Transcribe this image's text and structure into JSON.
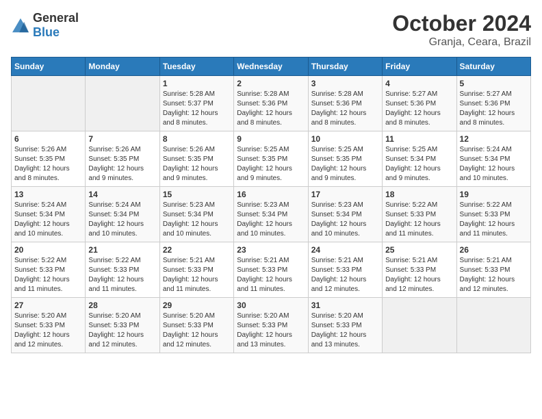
{
  "logo": {
    "general": "General",
    "blue": "Blue"
  },
  "title": {
    "month": "October 2024",
    "location": "Granja, Ceara, Brazil"
  },
  "weekdays": [
    "Sunday",
    "Monday",
    "Tuesday",
    "Wednesday",
    "Thursday",
    "Friday",
    "Saturday"
  ],
  "weeks": [
    [
      {
        "day": "",
        "info": ""
      },
      {
        "day": "",
        "info": ""
      },
      {
        "day": "1",
        "info": "Sunrise: 5:28 AM\nSunset: 5:37 PM\nDaylight: 12 hours and 8 minutes."
      },
      {
        "day": "2",
        "info": "Sunrise: 5:28 AM\nSunset: 5:36 PM\nDaylight: 12 hours and 8 minutes."
      },
      {
        "day": "3",
        "info": "Sunrise: 5:28 AM\nSunset: 5:36 PM\nDaylight: 12 hours and 8 minutes."
      },
      {
        "day": "4",
        "info": "Sunrise: 5:27 AM\nSunset: 5:36 PM\nDaylight: 12 hours and 8 minutes."
      },
      {
        "day": "5",
        "info": "Sunrise: 5:27 AM\nSunset: 5:36 PM\nDaylight: 12 hours and 8 minutes."
      }
    ],
    [
      {
        "day": "6",
        "info": "Sunrise: 5:26 AM\nSunset: 5:35 PM\nDaylight: 12 hours and 8 minutes."
      },
      {
        "day": "7",
        "info": "Sunrise: 5:26 AM\nSunset: 5:35 PM\nDaylight: 12 hours and 9 minutes."
      },
      {
        "day": "8",
        "info": "Sunrise: 5:26 AM\nSunset: 5:35 PM\nDaylight: 12 hours and 9 minutes."
      },
      {
        "day": "9",
        "info": "Sunrise: 5:25 AM\nSunset: 5:35 PM\nDaylight: 12 hours and 9 minutes."
      },
      {
        "day": "10",
        "info": "Sunrise: 5:25 AM\nSunset: 5:35 PM\nDaylight: 12 hours and 9 minutes."
      },
      {
        "day": "11",
        "info": "Sunrise: 5:25 AM\nSunset: 5:34 PM\nDaylight: 12 hours and 9 minutes."
      },
      {
        "day": "12",
        "info": "Sunrise: 5:24 AM\nSunset: 5:34 PM\nDaylight: 12 hours and 10 minutes."
      }
    ],
    [
      {
        "day": "13",
        "info": "Sunrise: 5:24 AM\nSunset: 5:34 PM\nDaylight: 12 hours and 10 minutes."
      },
      {
        "day": "14",
        "info": "Sunrise: 5:24 AM\nSunset: 5:34 PM\nDaylight: 12 hours and 10 minutes."
      },
      {
        "day": "15",
        "info": "Sunrise: 5:23 AM\nSunset: 5:34 PM\nDaylight: 12 hours and 10 minutes."
      },
      {
        "day": "16",
        "info": "Sunrise: 5:23 AM\nSunset: 5:34 PM\nDaylight: 12 hours and 10 minutes."
      },
      {
        "day": "17",
        "info": "Sunrise: 5:23 AM\nSunset: 5:34 PM\nDaylight: 12 hours and 10 minutes."
      },
      {
        "day": "18",
        "info": "Sunrise: 5:22 AM\nSunset: 5:33 PM\nDaylight: 12 hours and 11 minutes."
      },
      {
        "day": "19",
        "info": "Sunrise: 5:22 AM\nSunset: 5:33 PM\nDaylight: 12 hours and 11 minutes."
      }
    ],
    [
      {
        "day": "20",
        "info": "Sunrise: 5:22 AM\nSunset: 5:33 PM\nDaylight: 12 hours and 11 minutes."
      },
      {
        "day": "21",
        "info": "Sunrise: 5:22 AM\nSunset: 5:33 PM\nDaylight: 12 hours and 11 minutes."
      },
      {
        "day": "22",
        "info": "Sunrise: 5:21 AM\nSunset: 5:33 PM\nDaylight: 12 hours and 11 minutes."
      },
      {
        "day": "23",
        "info": "Sunrise: 5:21 AM\nSunset: 5:33 PM\nDaylight: 12 hours and 11 minutes."
      },
      {
        "day": "24",
        "info": "Sunrise: 5:21 AM\nSunset: 5:33 PM\nDaylight: 12 hours and 12 minutes."
      },
      {
        "day": "25",
        "info": "Sunrise: 5:21 AM\nSunset: 5:33 PM\nDaylight: 12 hours and 12 minutes."
      },
      {
        "day": "26",
        "info": "Sunrise: 5:21 AM\nSunset: 5:33 PM\nDaylight: 12 hours and 12 minutes."
      }
    ],
    [
      {
        "day": "27",
        "info": "Sunrise: 5:20 AM\nSunset: 5:33 PM\nDaylight: 12 hours and 12 minutes."
      },
      {
        "day": "28",
        "info": "Sunrise: 5:20 AM\nSunset: 5:33 PM\nDaylight: 12 hours and 12 minutes."
      },
      {
        "day": "29",
        "info": "Sunrise: 5:20 AM\nSunset: 5:33 PM\nDaylight: 12 hours and 12 minutes."
      },
      {
        "day": "30",
        "info": "Sunrise: 5:20 AM\nSunset: 5:33 PM\nDaylight: 12 hours and 13 minutes."
      },
      {
        "day": "31",
        "info": "Sunrise: 5:20 AM\nSunset: 5:33 PM\nDaylight: 12 hours and 13 minutes."
      },
      {
        "day": "",
        "info": ""
      },
      {
        "day": "",
        "info": ""
      }
    ]
  ]
}
